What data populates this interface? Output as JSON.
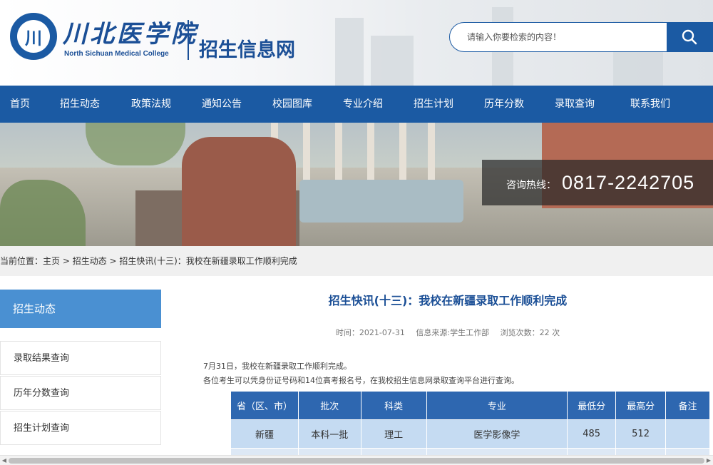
{
  "header": {
    "logo_glyph": "川",
    "logo_cn": "川北医学院",
    "logo_en": "North Sichuan Medical College",
    "site_name": "招生信息网"
  },
  "search": {
    "placeholder": "请输入你要检索的内容！",
    "icon": "search-icon"
  },
  "nav": {
    "items": [
      "首页",
      "招生动态",
      "政策法规",
      "通知公告",
      "校园图库",
      "专业介绍",
      "招生计划",
      "历年分数",
      "录取查询",
      "联系我们"
    ]
  },
  "hotline": {
    "label": "咨询热线：",
    "number": "0817-2242705"
  },
  "breadcrumb": {
    "prefix": "当前位置：",
    "home": "主页",
    "sep": " > ",
    "section": "招生动态",
    "current": "招生快讯(十三)：我校在新疆录取工作顺利完成"
  },
  "sidebar": {
    "title": "招生动态",
    "items": [
      "录取结果查询",
      "历年分数查询",
      "招生计划查询"
    ]
  },
  "article": {
    "title": "招生快讯(十三)：我校在新疆录取工作顺利完成",
    "time": "时间：2021-07-31",
    "source": "信息来源:学生工作部",
    "views": "浏览次数：22 次",
    "p1": "7月31日，我校在新疆录取工作顺利完成。",
    "p2": "各位考生可以凭身份证号码和14位高考报名号，在我校招生信息网录取查询平台进行查询。"
  },
  "table": {
    "headers": [
      "省（区、市）",
      "批次",
      "科类",
      "专业",
      "最低分",
      "最高分",
      "备注"
    ],
    "rows": [
      [
        "新疆",
        "本科一批",
        "理工",
        "医学影像学",
        "485",
        "512",
        ""
      ]
    ]
  },
  "colors": {
    "brand": "#1b5aa3",
    "sidebar_active": "#4a90d2",
    "table_header": "#2e67b0",
    "table_row": "#c5dbf2"
  }
}
